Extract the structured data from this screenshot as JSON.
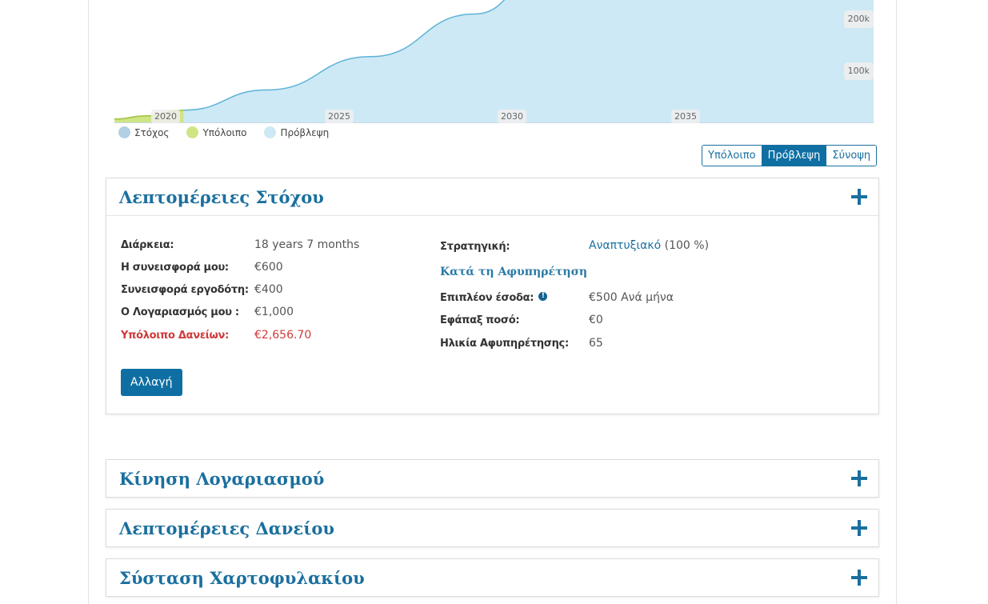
{
  "chart_data": {
    "type": "area",
    "x_ticks": [
      "2020",
      "2025",
      "2030",
      "2035"
    ],
    "y_ticks": [
      "200k",
      "100k"
    ],
    "legend": [
      {
        "name": "Στόχος",
        "color": "#b3cfe3"
      },
      {
        "name": "Υπόλοιπο",
        "color": "#cfe585"
      },
      {
        "name": "Πρόβλεψη",
        "color": "#cde9f5"
      }
    ],
    "series": [
      {
        "name": "Υπόλοιπο",
        "x": [
          2018.6,
          2019.5,
          2020.6
        ],
        "values": [
          8000,
          14000,
          25000
        ]
      },
      {
        "name": "Πρόβλεψη",
        "x": [
          2020.6,
          2023,
          2026,
          2029,
          2031,
          2033
        ],
        "values": [
          25000,
          64000,
          128000,
          210000,
          285000,
          370000
        ]
      }
    ],
    "xlim": [
      2018.6,
      2040
    ],
    "ylim": [
      0,
      240000
    ]
  },
  "view_toggle": {
    "options": [
      "Υπόλοιπο",
      "Πρόβλεψη",
      "Σύνοψη"
    ],
    "active": "Πρόβλεψη"
  },
  "goal_details": {
    "title": "Λεπτομέρειες Στόχου",
    "left": [
      {
        "label": "Διάρκεια:",
        "value": "18 years 7 months"
      },
      {
        "label": "Η συνεισφορά μου:",
        "value": "€600"
      },
      {
        "label": "Συνεισφορά εργοδότη:",
        "value": "€400"
      },
      {
        "label": "Ο Λογαριασμός μου :",
        "value": "€1,000"
      },
      {
        "label": "Υπόλοιπο Δανείων:",
        "value": "€2,656.70"
      }
    ],
    "strategy_label": "Στρατηγική:",
    "strategy_link": "Αναπτυξιακό",
    "strategy_pct": "(100 %)",
    "retirement_heading": "Κατά τη Αφυπηρέτηση",
    "right": [
      {
        "label": "Επιπλέον έσοδα:",
        "value": "€500 Ανά μήνα"
      },
      {
        "label": "Εφάπαξ ποσό:",
        "value": "€0"
      },
      {
        "label": "Ηλικία Αφυπηρέτησης:",
        "value": "65"
      }
    ],
    "info_glyph": "!",
    "change_button": "Αλλαγή"
  },
  "panels": [
    {
      "title": "Κίνηση Λογαριασμού"
    },
    {
      "title": "Λεπτομέρειες Δανείου"
    },
    {
      "title": "Σύσταση Χαρτοφυλακίου"
    }
  ]
}
